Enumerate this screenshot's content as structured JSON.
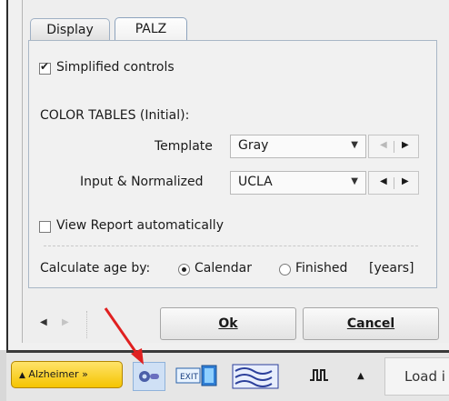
{
  "tabs": [
    {
      "label": "Display",
      "active": false
    },
    {
      "label": "PALZ",
      "active": true
    }
  ],
  "simplified_controls": {
    "label": "Simplified controls",
    "checked": true
  },
  "color_tables": {
    "heading": "COLOR TABLES (Initial):",
    "template": {
      "label": "Template",
      "value": "Gray"
    },
    "input_normalized": {
      "label": "Input & Normalized",
      "value": "UCLA"
    }
  },
  "view_report": {
    "label": "View Report automatically",
    "checked": false
  },
  "age": {
    "label": "Calculate age by:",
    "options": [
      {
        "label": "Calendar",
        "selected": true
      },
      {
        "label": "Finished",
        "selected": false
      }
    ],
    "unit": "[years]"
  },
  "buttons": {
    "ok_label": "Ok",
    "cancel_label": "Cancel"
  },
  "taskbar": {
    "alzheimer_label": "Alzheimer »",
    "exit_label": "EXIT",
    "load_label": "Load i"
  },
  "colors": {
    "accent_yellow": "#f5c400",
    "arrow_red": "#e02020",
    "tab_border": "#8da3bd"
  }
}
